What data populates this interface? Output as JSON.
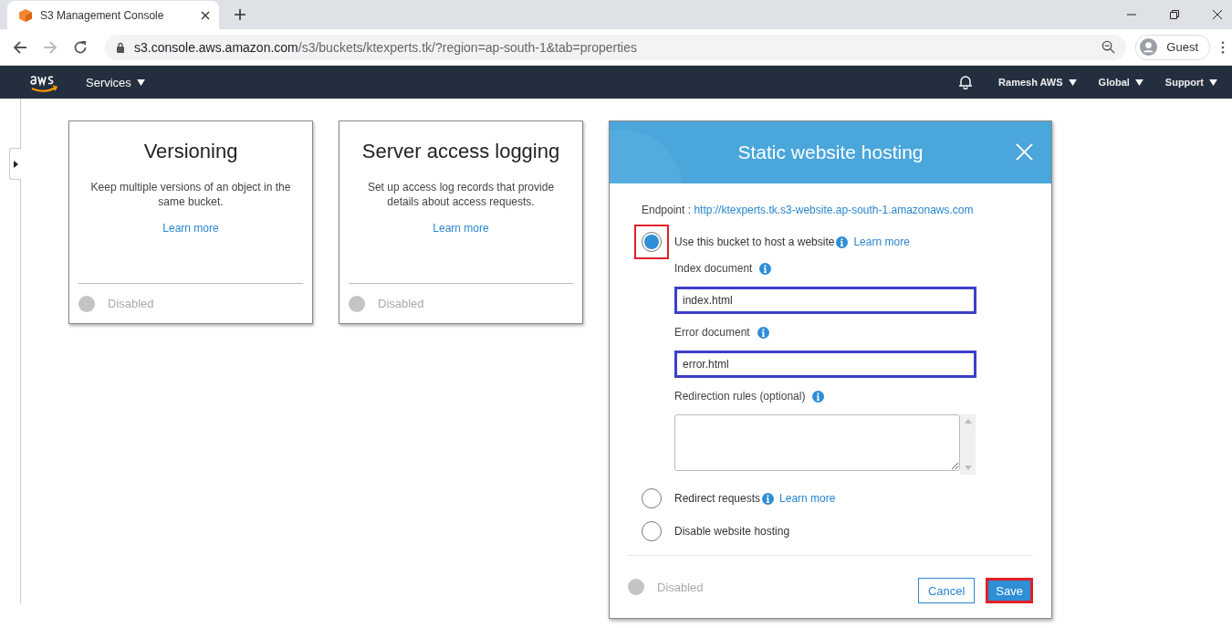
{
  "browser": {
    "tab_title": "S3 Management Console",
    "url_host": "s3.console.aws.amazon.com",
    "url_path": "/s3/buckets/ktexperts.tk/?region=ap-south-1&tab=properties",
    "profile": "Guest"
  },
  "nav": {
    "services": "Services",
    "menus": [
      "Ramesh AWS",
      "Global",
      "Support"
    ]
  },
  "cards": [
    {
      "title": "Versioning",
      "description": "Keep multiple versions of an object in the same bucket.",
      "link": "Learn more",
      "status": "Disabled",
      "enabled": false
    },
    {
      "title": "Server access logging",
      "description": "Set up access log records that provide details about access requests.",
      "link": "Learn more",
      "status": "Disabled",
      "enabled": false
    }
  ],
  "modal": {
    "title": "Static website hosting",
    "endpoint_label": "Endpoint :",
    "endpoint_url": "http://ktexperts.tk.s3-website.ap-south-1.amazonaws.com",
    "options": [
      {
        "label": "Use this bucket to host a website",
        "link": "Learn more",
        "selected": true,
        "highlighted": true,
        "fields": [
          {
            "kind": "input",
            "label": "Index document",
            "value": "index.html",
            "highlighted": true
          },
          {
            "kind": "input",
            "label": "Error document",
            "value": "error.html",
            "highlighted": true
          },
          {
            "kind": "textarea",
            "label": "Redirection rules (optional)",
            "highlighted": false
          }
        ]
      },
      {
        "label": "Redirect requests",
        "link": "Learn more",
        "selected": false,
        "highlighted": false
      },
      {
        "label": "Disable website hosting",
        "selected": false,
        "highlighted": false
      }
    ],
    "status": "Disabled",
    "enabled": false,
    "buttons": [
      {
        "label": "Cancel",
        "primary": false,
        "highlighted": false
      },
      {
        "label": "Save",
        "primary": true,
        "highlighted": true
      }
    ]
  }
}
